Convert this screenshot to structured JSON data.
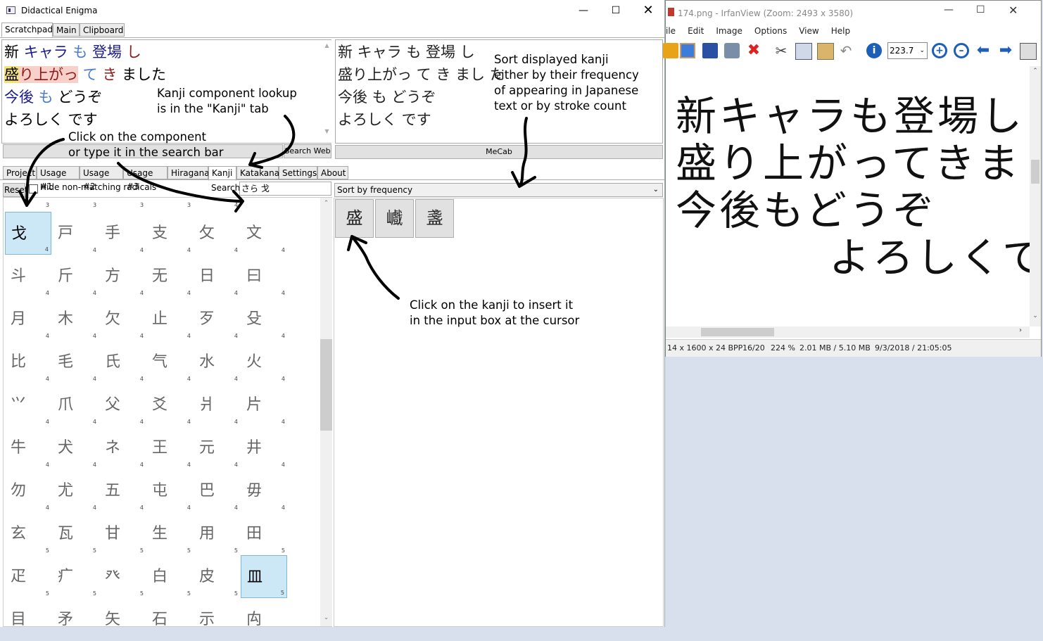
{
  "de": {
    "title": "Didactical Enigma",
    "tabs": [
      "Scratchpad",
      "Main",
      "Clipboard"
    ],
    "left_lines": [
      [
        {
          "t": "新 ",
          "c": "#000"
        },
        {
          "t": "キャラ",
          "c": "#1a1a8c"
        },
        {
          "t": " も ",
          "c": "#4a7cc9"
        },
        {
          "t": "登場",
          "c": "#1a1a8c"
        },
        {
          "t": " し",
          "c": "#8b1a1a"
        }
      ],
      [
        {
          "t": "盛",
          "c": "#000",
          "bg": "#f5e07a"
        },
        {
          "t": "り上がっ",
          "c": "#8b1a1a",
          "bg": "#f6d0c9"
        },
        {
          "t": " て",
          "c": "#4a7cc9"
        },
        {
          "t": " き",
          "c": "#8b1a1a"
        },
        {
          "t": " ました",
          "c": "#000"
        }
      ],
      [
        {
          "t": "今後",
          "c": "#1a1a8c"
        },
        {
          "t": " も ",
          "c": "#4a7cc9"
        },
        {
          "t": "どうぞ",
          "c": "#000"
        }
      ],
      [
        {
          "t": "よろしく です",
          "c": "#000"
        }
      ]
    ],
    "right_lines": [
      "新 キャラ も 登場 し",
      "盛り上がっ て き まし た",
      "今後 も どうぞ",
      "よろしく です"
    ],
    "search_web": "Search Web",
    "mecab": "MeCab",
    "mid_tabs": [
      "Project",
      "Usage #1",
      "Usage #2",
      "Usage #3",
      "Hiragana",
      "Kanji",
      "Katakana",
      "Settings",
      "About"
    ],
    "reset": "Reset",
    "hide_label": "Hide non-matching radicals",
    "search_label": "Search:",
    "search_value": "さら 戈",
    "sort_value": "Sort by frequency",
    "header_strokes": [
      "3",
      "3",
      "3",
      "3",
      "4"
    ],
    "radicals": [
      [
        "戈",
        "4",
        true
      ],
      [
        "戸",
        "4",
        false
      ],
      [
        "手",
        "4",
        false
      ],
      [
        "支",
        "4",
        false
      ],
      [
        "攵",
        "4",
        false
      ],
      [
        "文",
        "4",
        false
      ],
      [
        "斗",
        "4",
        false
      ],
      [
        "斤",
        "4",
        false
      ],
      [
        "方",
        "4",
        false
      ],
      [
        "无",
        "4",
        false
      ],
      [
        "日",
        "4",
        false
      ],
      [
        "曰",
        "4",
        false
      ],
      [
        "月",
        "4",
        false
      ],
      [
        "木",
        "4",
        false
      ],
      [
        "欠",
        "4",
        false
      ],
      [
        "止",
        "4",
        false
      ],
      [
        "歹",
        "4",
        false
      ],
      [
        "殳",
        "4",
        false
      ],
      [
        "比",
        "4",
        false
      ],
      [
        "毛",
        "4",
        false
      ],
      [
        "氏",
        "4",
        false
      ],
      [
        "气",
        "4",
        false
      ],
      [
        "水",
        "4",
        false
      ],
      [
        "火",
        "4",
        false
      ],
      [
        "⺍",
        "4",
        false
      ],
      [
        "爪",
        "4",
        false
      ],
      [
        "父",
        "4",
        false
      ],
      [
        "爻",
        "4",
        false
      ],
      [
        "爿",
        "4",
        false
      ],
      [
        "片",
        "4",
        false
      ],
      [
        "牛",
        "4",
        false
      ],
      [
        "犬",
        "4",
        false
      ],
      [
        "ネ",
        "4",
        false
      ],
      [
        "王",
        "4",
        false
      ],
      [
        "元",
        "4",
        false
      ],
      [
        "井",
        "4",
        false
      ],
      [
        "勿",
        "4",
        false
      ],
      [
        "尤",
        "4",
        false
      ],
      [
        "五",
        "4",
        false
      ],
      [
        "屯",
        "4",
        false
      ],
      [
        "巴",
        "4",
        false
      ],
      [
        "毋",
        "4",
        false
      ],
      [
        "玄",
        "5",
        false
      ],
      [
        "瓦",
        "5",
        false
      ],
      [
        "甘",
        "5",
        false
      ],
      [
        "生",
        "5",
        false
      ],
      [
        "用",
        "5",
        false
      ],
      [
        "田",
        "5",
        false
      ],
      [
        "疋",
        "5",
        false
      ],
      [
        "疒",
        "5",
        false
      ],
      [
        "癶",
        "5",
        false
      ],
      [
        "白",
        "5",
        false
      ],
      [
        "皮",
        "5",
        false
      ],
      [
        "皿",
        "5",
        true
      ],
      [
        "目",
        "",
        false
      ],
      [
        "矛",
        "",
        false
      ],
      [
        "矢",
        "",
        false
      ],
      [
        "石",
        "",
        false
      ],
      [
        "示",
        "",
        false
      ],
      [
        "禸",
        "",
        false
      ]
    ],
    "kanji_results": [
      "盛",
      "巇",
      "盞"
    ]
  },
  "annotations": {
    "component_lookup": [
      "Kanji component lookup",
      "is in the \"Kanji\" tab"
    ],
    "click_component": [
      "Click on the component",
      "or type it in the search bar"
    ],
    "sort_kanji": [
      "Sort displayed kanji",
      "either by their frequency",
      "of appearing in Japanese",
      "text or by stroke count"
    ],
    "click_kanji": [
      "Click on the kanji to insert it",
      "in the input box at the cursor"
    ]
  },
  "iv": {
    "title": "174.png - IrfanView (Zoom: 2493 x 3580)",
    "menu": [
      "ile",
      "Edit",
      "Image",
      "Options",
      "View",
      "Help"
    ],
    "zoom_value": "223.7",
    "image_lines": [
      "新キャラも登場し",
      "盛り上がってきました",
      "今後もどうぞ",
      "よろしくです"
    ],
    "status": [
      "14 x 1600 x 24 BPP",
      "16/20",
      "224 %",
      "2.01 MB / 5.10 MB",
      "9/3/2018 / 21:05:05"
    ]
  }
}
